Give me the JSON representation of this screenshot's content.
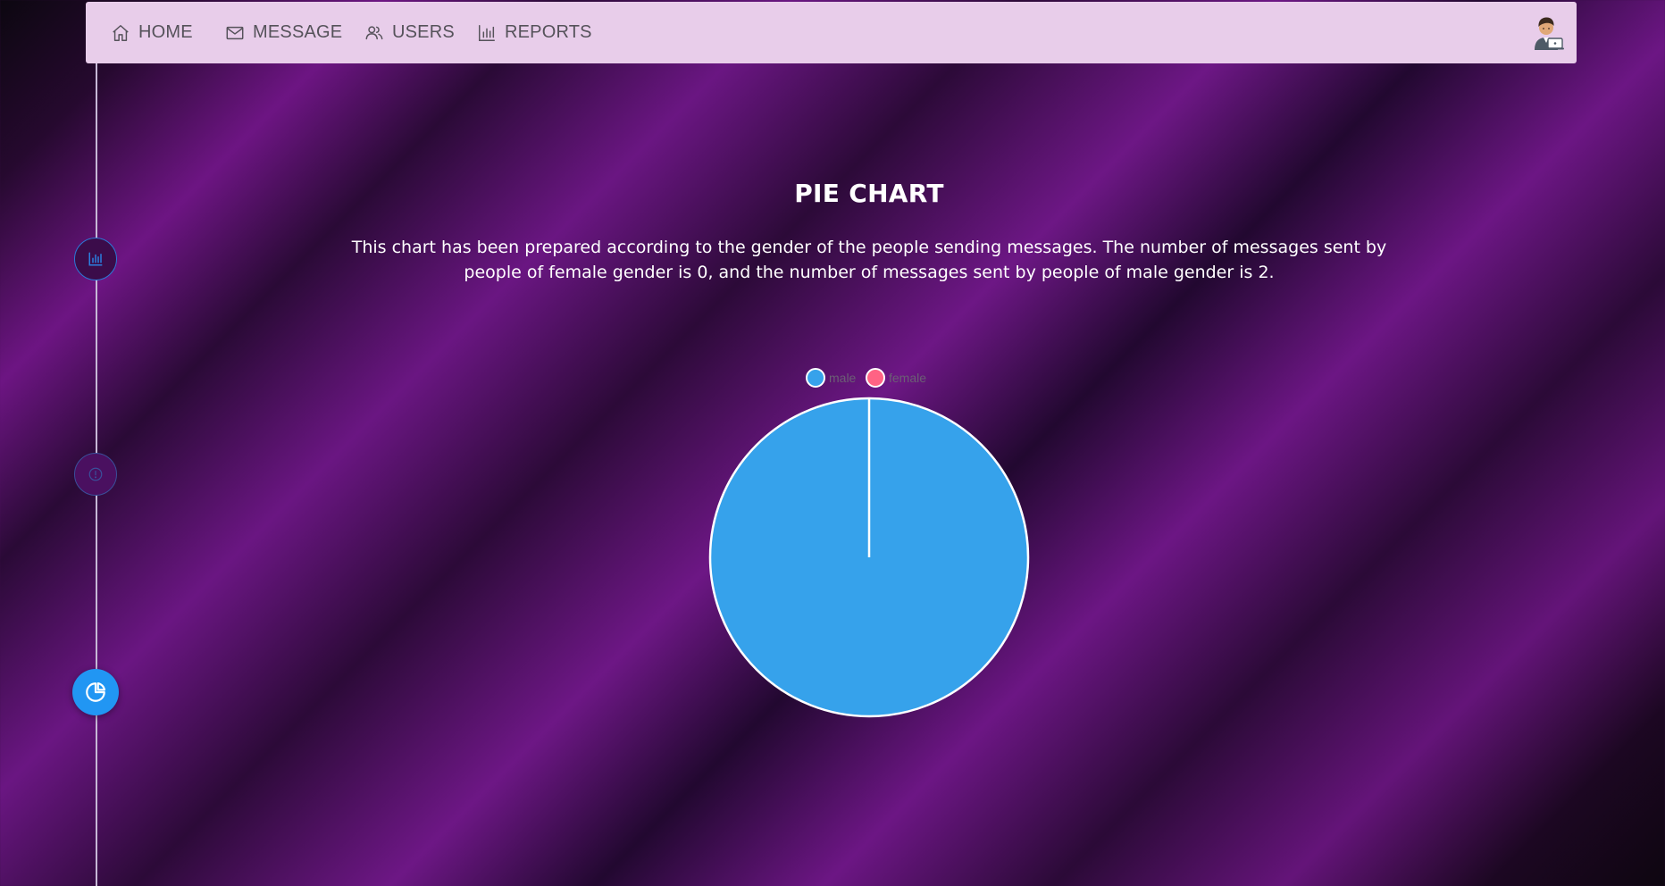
{
  "nav": {
    "items": [
      {
        "label": "HOME",
        "icon": "home-icon"
      },
      {
        "label": "MESSAGE",
        "icon": "mail-icon"
      },
      {
        "label": "USERS",
        "icon": "users-icon"
      },
      {
        "label": "REPORTS",
        "icon": "bar-chart-icon"
      }
    ],
    "avatar_icon": "user-avatar-icon"
  },
  "timeline": {
    "steps": [
      {
        "icon": "bar-chart-icon",
        "state": "inactive"
      },
      {
        "icon": "info-icon",
        "state": "inactive"
      },
      {
        "icon": "pie-chart-icon",
        "state": "active"
      }
    ]
  },
  "main": {
    "title": "PIE CHART",
    "description": "This chart has been prepared according to the gender of the people sending messages. The number of messages sent by people of female gender is 0, and the number of messages sent by people of male gender is 2."
  },
  "colors": {
    "male": "#36a2eb",
    "female": "#ff6384",
    "accent": "#2196f3",
    "navbar": "#e8cdea"
  },
  "chart_data": {
    "type": "pie",
    "categories": [
      "male",
      "female"
    ],
    "values": [
      2,
      0
    ],
    "colors": [
      "#36a2eb",
      "#ff6384"
    ],
    "legend": "top"
  }
}
